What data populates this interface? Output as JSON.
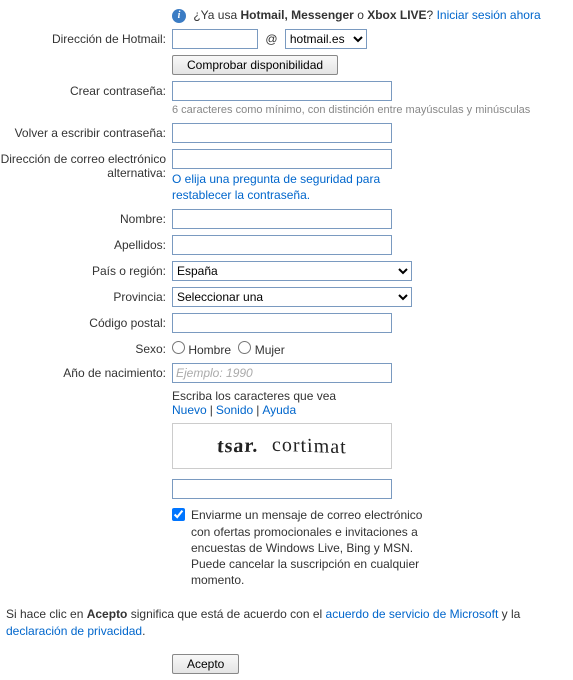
{
  "intro": {
    "prefix": "¿Ya usa ",
    "brands": "Hotmail, Messenger",
    "or": " o ",
    "brand3": "Xbox LIVE",
    "q": "? ",
    "signin_link": "Iniciar sesión ahora"
  },
  "labels": {
    "email": "Dirección de Hotmail:",
    "check": "Comprobar disponibilidad",
    "create_pw": "Crear contraseña:",
    "pw_hint": "6 caracteres como mínimo, con distinción entre mayúsculas y minúsculas",
    "repeat_pw": "Volver a escribir contraseña:",
    "alt_email_l1": "Dirección de correo electrónico",
    "alt_email_l2": "alternativa:",
    "alt_hint": "O elija una pregunta de seguridad para restablecer la contraseña.",
    "firstname": "Nombre:",
    "lastname": "Apellidos:",
    "country": "País o región:",
    "province": "Provincia:",
    "postal": "Código postal:",
    "gender": "Sexo:",
    "male": "Hombre",
    "female": "Mujer",
    "birthyear": "Año de nacimiento:",
    "birthyear_placeholder": "Ejemplo: 1990",
    "captcha_prompt": "Escriba los caracteres que vea",
    "new": "Nuevo",
    "sound": "Sonido",
    "help": "Ayuda",
    "marketing": "Enviarme un mensaje de correo electrónico con ofertas promocionales e invitaciones a encuestas de Windows Live, Bing y MSN. Puede cancelar la suscripción en cualquier momento."
  },
  "at": "@",
  "domain_selected": "hotmail.es",
  "country_selected": "España",
  "province_selected": "Seleccionar una",
  "captcha_words": [
    "tsar.",
    "cortimat"
  ],
  "terms": {
    "t1": "Si hace clic en ",
    "accept_word": "Acepto",
    "t2": " significa que está de acuerdo con el ",
    "link1": "acuerdo de servicio de Microsoft",
    "t3": " y la ",
    "link2": "declaración de privacidad",
    "t4": "."
  },
  "accept_btn": "Acepto"
}
